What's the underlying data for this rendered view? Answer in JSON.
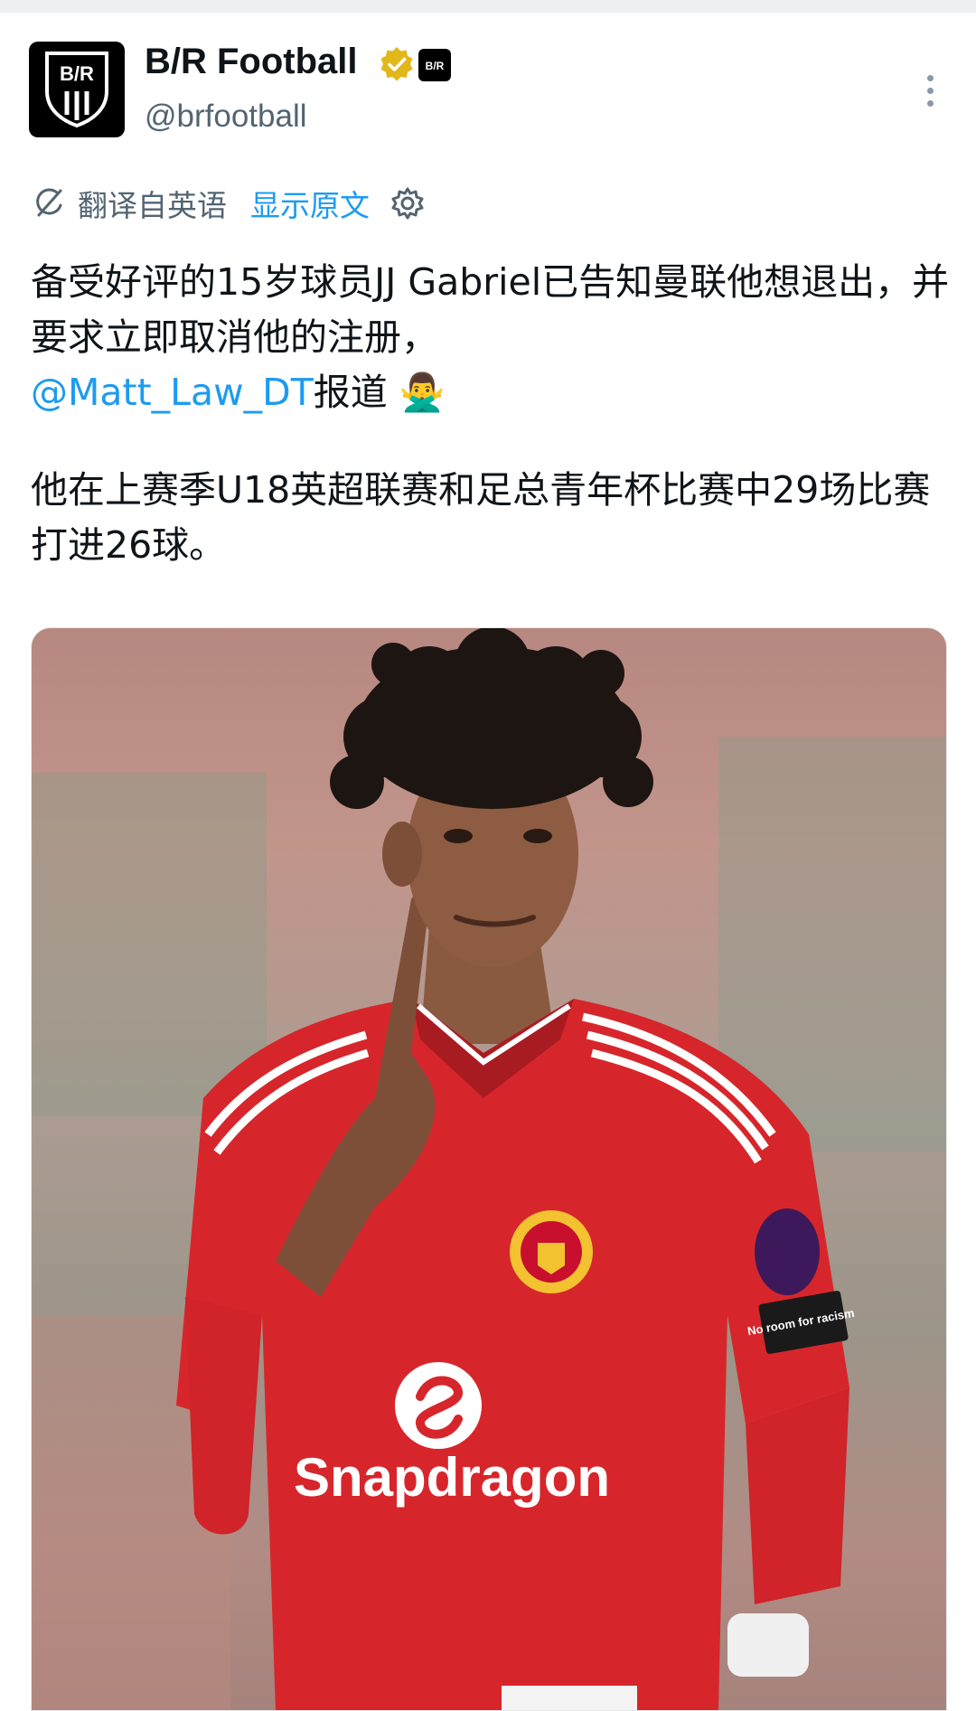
{
  "account": {
    "display_name": "B/R Football",
    "handle": "@brfootball",
    "avatar_text": "B/R",
    "affiliate_badge_text": "B/R"
  },
  "translation": {
    "label": "翻译自英语",
    "show_original": "显示原文"
  },
  "tweet": {
    "line1": "备受好评的15岁球员JJ Gabriel已告知曼联他想退出，并要求立即取消他的注册，",
    "mention": "@Matt_Law_DT",
    "after_mention": "报道 🙅‍♂️",
    "line2": "他在上赛季U18英超联赛和足总青年杯比赛中29场比赛打进26球。"
  },
  "media": {
    "sponsor_text": "Snapdragon",
    "badge_text": "No room for racism"
  },
  "colors": {
    "link": "#1d9bf0",
    "secondary_text": "#536471",
    "verified_gold": "#e2b719",
    "jersey_red": "#d7262b"
  },
  "icons": {
    "verified": "verified-badge-icon",
    "translate": "translate-icon",
    "settings": "gear-icon",
    "more": "more-vertical-icon"
  }
}
